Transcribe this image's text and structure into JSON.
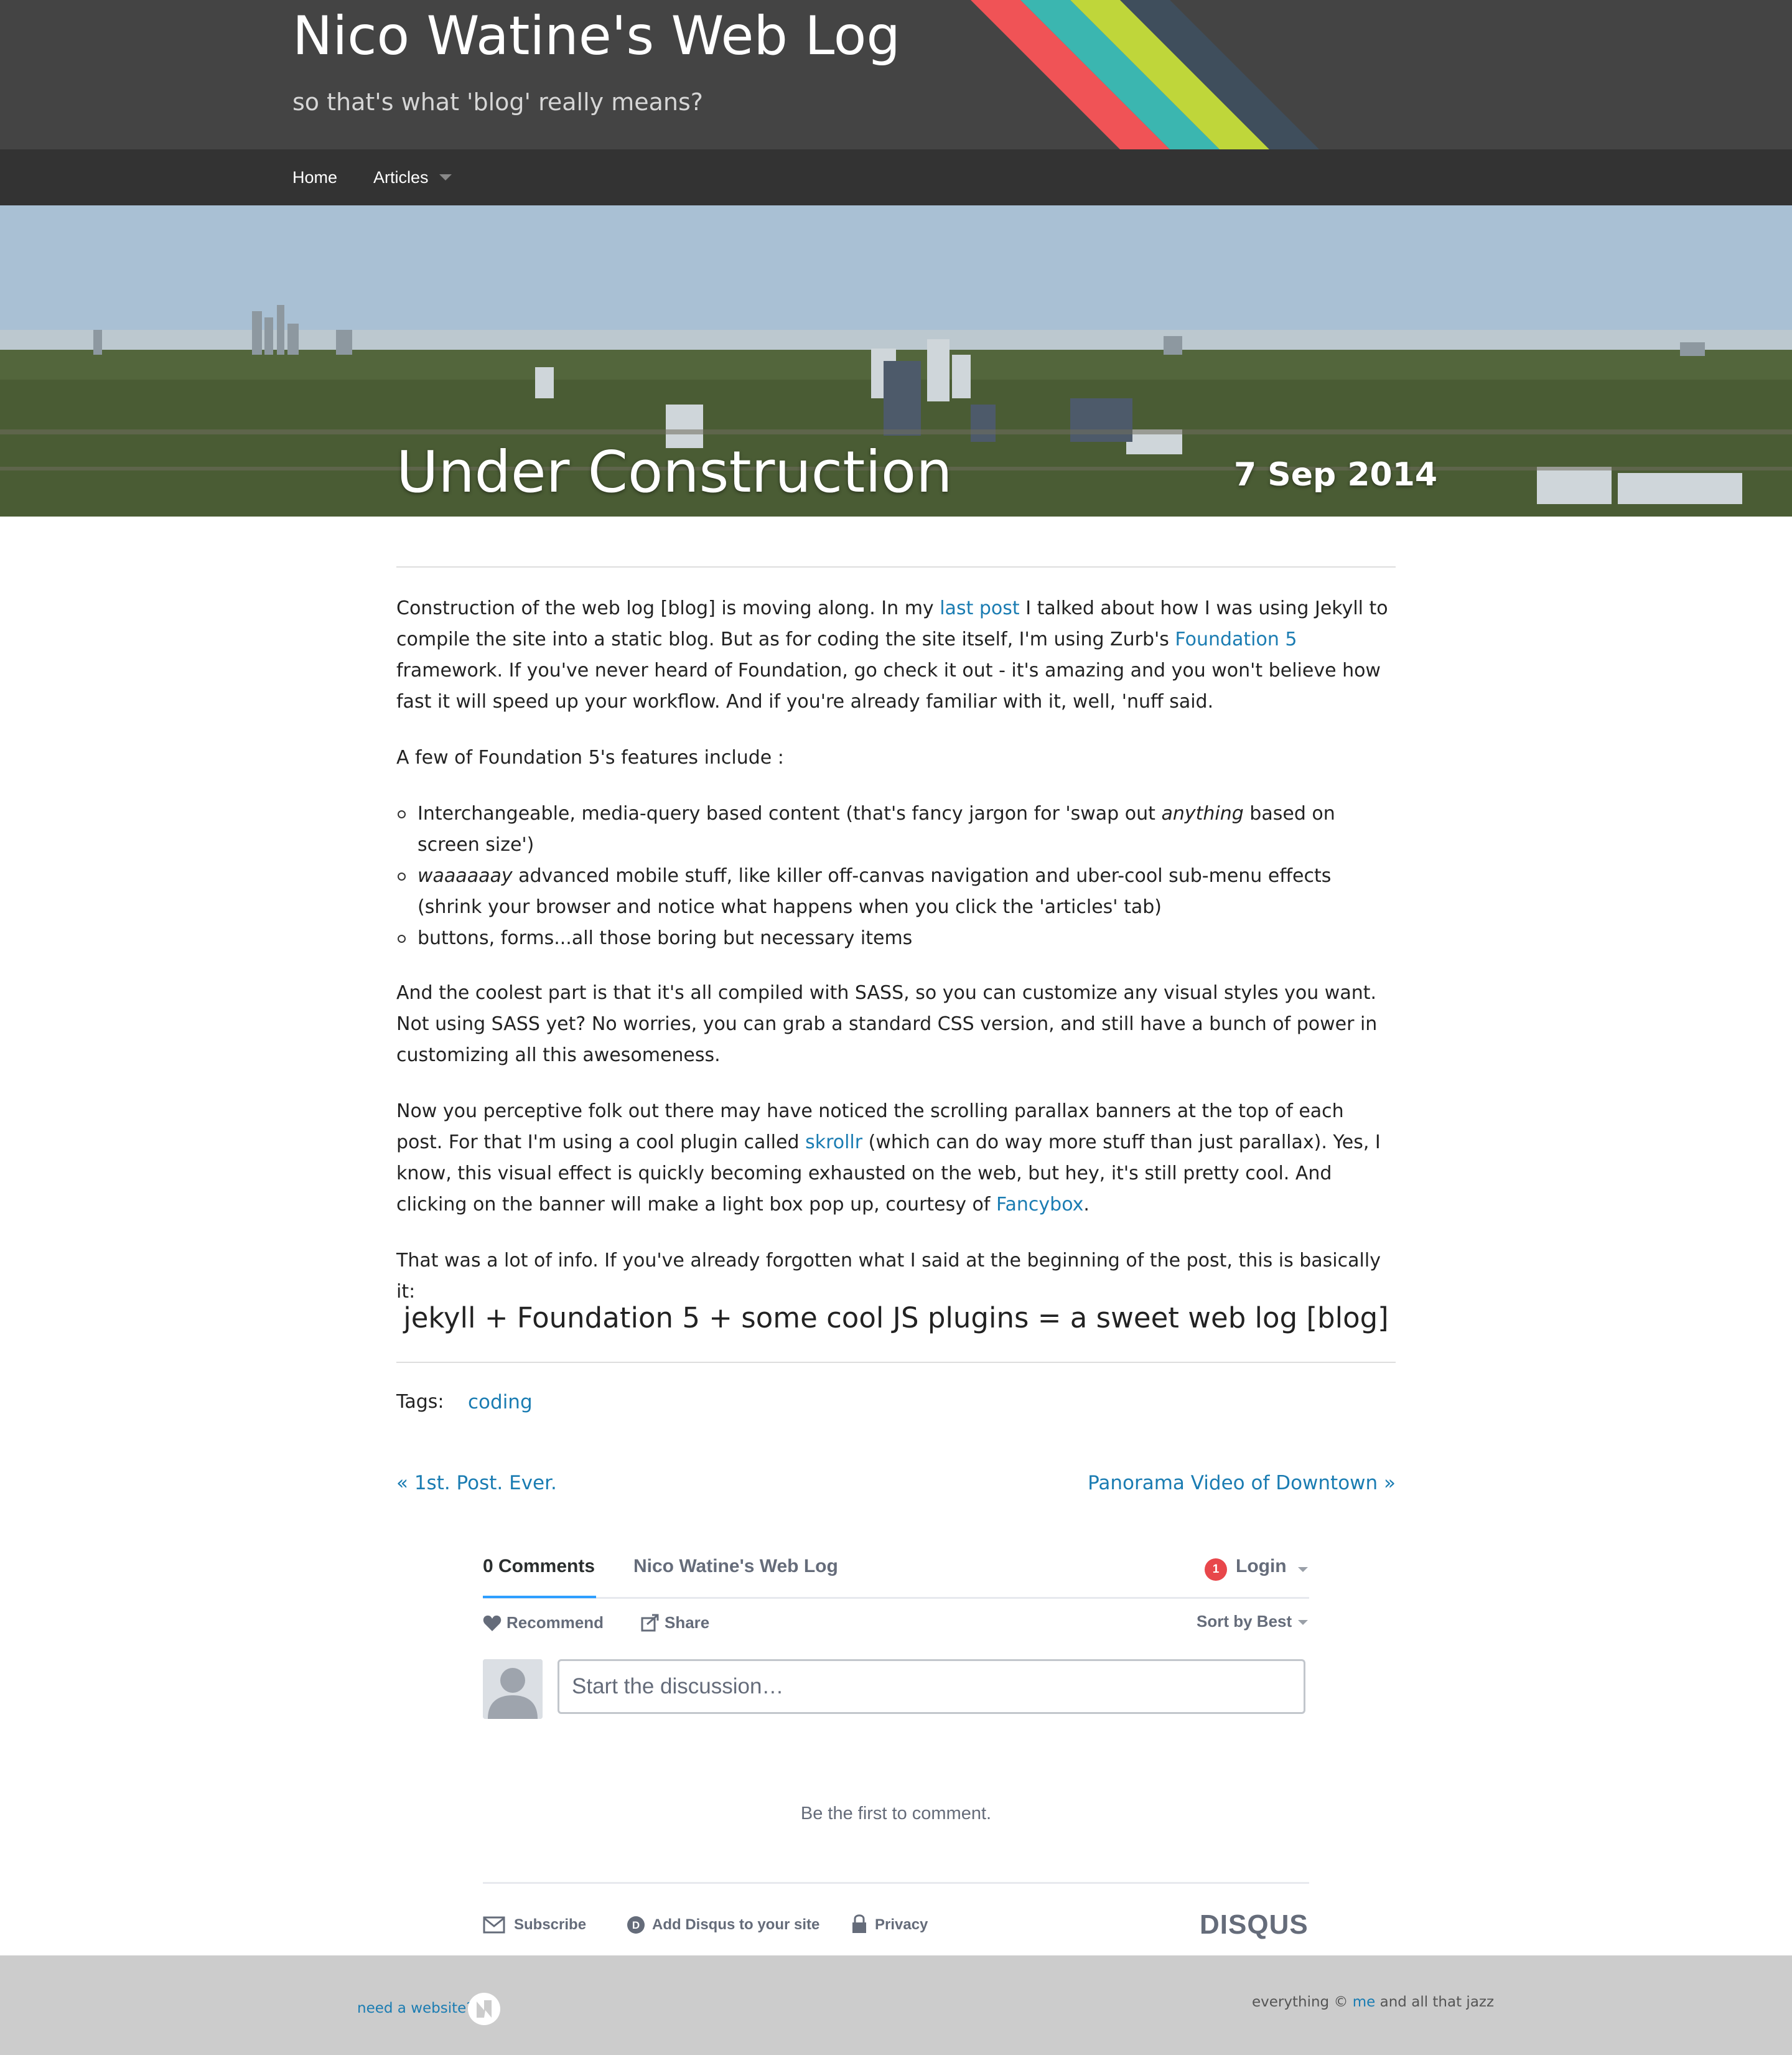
{
  "site": {
    "title": "Nico Watine's Web Log",
    "subtitle": "so that's what 'blog' really means?"
  },
  "nav": {
    "home": "Home",
    "articles": "Articles"
  },
  "post": {
    "title": "Under Construction",
    "date": "7 Sep 2014",
    "p1": {
      "a": "Construction of the web log [blog] is moving along. In my ",
      "link1": "last post",
      "b": " I talked about how I was using Jekyll to compile the site into a static blog. But as for coding the site itself, I'm using Zurb's ",
      "link2": "Foundation 5",
      "c": " framework. If you've never heard of Foundation, go check it out - it's amazing and you won't believe how fast it will speed up your workflow. And if you're already familiar with it, well, 'nuff said."
    },
    "p2": "A few of Foundation 5's features include :",
    "list": {
      "i1a": "Interchangeable, media-query based content (that's fancy jargon for 'swap out ",
      "i1em": "anything",
      "i1b": " based on screen size')",
      "i2em": "waaaaaay",
      "i2b": " advanced mobile stuff, like killer off-canvas navigation and uber-cool sub-menu effects (shrink your browser and notice what happens when you click the 'articles' tab)",
      "i3": "buttons, forms...all those boring but necessary items"
    },
    "p3": "And the coolest part is that it's all compiled with SASS, so you can customize any visual styles you want. Not using SASS yet? No worries, you can grab a standard CSS version, and still have a bunch of power in customizing all this awesomeness.",
    "p4": {
      "a": "Now you perceptive folk out there may have noticed the scrolling parallax banners at the top of each post. For that I'm using a cool plugin called ",
      "link1": "skrollr",
      "b": " (which can do way more stuff than just parallax). Yes, I know, this visual effect is quickly becoming exhausted on the web, but hey, it's still pretty cool. And clicking on the banner will make a light box pop up, courtesy of ",
      "link2": "Fancybox",
      "c": "."
    },
    "p5": "That was a lot of info. If you've already forgotten what I said at the beginning of the post, this is basically it:",
    "formula": "jekyll + Foundation 5 + some cool JS plugins = a sweet web log [blog]",
    "tags_label": "Tags:",
    "tag": "coding",
    "prev": "« 1st. Post. Ever.",
    "next": "Panorama Video of Downtown »"
  },
  "disqus": {
    "comments_tab": "0 Comments",
    "site_tab": "Nico Watine's Web Log",
    "notification_count": "1",
    "login": "Login",
    "recommend": "Recommend",
    "share": "Share",
    "sort": "Sort by Best",
    "placeholder": "Start the discussion…",
    "first": "Be the first to comment.",
    "subscribe": "Subscribe",
    "add_disqus": "Add Disqus to your site",
    "privacy": "Privacy",
    "logo": "DISQUS",
    "accent": "#2e9fff",
    "badge_color": "#e8474b"
  },
  "footer": {
    "need_website": "need a website?",
    "copyright_a": "everything © ",
    "me": "me",
    "copyright_b": " and all that jazz"
  },
  "colors": {
    "header_bg": "#444444",
    "nav_bg": "#333333",
    "link": "#1a7cb2",
    "stripe_red": "#f05356",
    "stripe_teal": "#3bb6b0",
    "stripe_lime": "#bfd63a",
    "stripe_slate": "#3f4e5c",
    "footer_bg": "#cccccc"
  }
}
